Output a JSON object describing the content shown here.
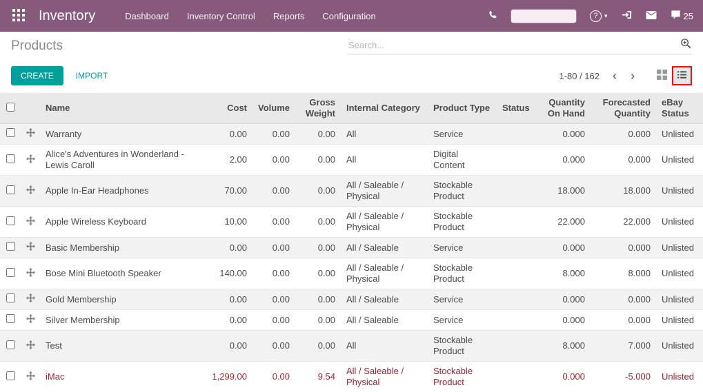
{
  "colors": {
    "brand": "#875A7B",
    "primary_button": "#00A09D",
    "danger_row": "#a2252f",
    "annotation": "#ec1111"
  },
  "navbar": {
    "app_title": "Inventory",
    "menu": [
      "Dashboard",
      "Inventory Control",
      "Reports",
      "Configuration"
    ],
    "help_label": "?",
    "messages_count": "25"
  },
  "page": {
    "title": "Products",
    "search_placeholder": "Search..."
  },
  "toolbar": {
    "create_label": "CREATE",
    "import_label": "IMPORT",
    "pager_text": "1-80 / 162",
    "prev_label": "‹",
    "next_label": "›",
    "active_view": "list"
  },
  "table": {
    "headers": [
      "Name",
      "Cost",
      "Volume",
      "Gross Weight",
      "Internal Category",
      "Product Type",
      "Status",
      "Quantity On Hand",
      "Forecasted Quantity",
      "eBay Status"
    ],
    "rows": [
      {
        "name": "Warranty",
        "cost": "0.00",
        "volume": "0.00",
        "gross_weight": "0.00",
        "category": "All",
        "type": "Service",
        "status": "",
        "qty_on_hand": "0.000",
        "forecasted": "0.000",
        "ebay_status": "Unlisted",
        "danger": false
      },
      {
        "name": "Alice's Adventures in Wonderland - Lewis Caroll",
        "cost": "2.00",
        "volume": "0.00",
        "gross_weight": "0.00",
        "category": "All",
        "type": "Digital Content",
        "status": "",
        "qty_on_hand": "0.000",
        "forecasted": "0.000",
        "ebay_status": "Unlisted",
        "danger": false
      },
      {
        "name": "Apple In-Ear Headphones",
        "cost": "70.00",
        "volume": "0.00",
        "gross_weight": "0.00",
        "category": "All / Saleable / Physical",
        "type": "Stockable Product",
        "status": "",
        "qty_on_hand": "18.000",
        "forecasted": "18.000",
        "ebay_status": "Unlisted",
        "danger": false
      },
      {
        "name": "Apple Wireless Keyboard",
        "cost": "10.00",
        "volume": "0.00",
        "gross_weight": "0.00",
        "category": "All / Saleable / Physical",
        "type": "Stockable Product",
        "status": "",
        "qty_on_hand": "22.000",
        "forecasted": "22.000",
        "ebay_status": "Unlisted",
        "danger": false
      },
      {
        "name": "Basic Membership",
        "cost": "0.00",
        "volume": "0.00",
        "gross_weight": "0.00",
        "category": "All / Saleable",
        "type": "Service",
        "status": "",
        "qty_on_hand": "0.000",
        "forecasted": "0.000",
        "ebay_status": "Unlisted",
        "danger": false
      },
      {
        "name": "Bose Mini Bluetooth Speaker",
        "cost": "140.00",
        "volume": "0.00",
        "gross_weight": "0.00",
        "category": "All / Saleable / Physical",
        "type": "Stockable Product",
        "status": "",
        "qty_on_hand": "8.000",
        "forecasted": "8.000",
        "ebay_status": "Unlisted",
        "danger": false
      },
      {
        "name": "Gold Membership",
        "cost": "0.00",
        "volume": "0.00",
        "gross_weight": "0.00",
        "category": "All / Saleable",
        "type": "Service",
        "status": "",
        "qty_on_hand": "0.000",
        "forecasted": "0.000",
        "ebay_status": "Unlisted",
        "danger": false
      },
      {
        "name": "Silver Membership",
        "cost": "0.00",
        "volume": "0.00",
        "gross_weight": "0.00",
        "category": "All / Saleable",
        "type": "Service",
        "status": "",
        "qty_on_hand": "0.000",
        "forecasted": "0.000",
        "ebay_status": "Unlisted",
        "danger": false
      },
      {
        "name": "Test",
        "cost": "0.00",
        "volume": "0.00",
        "gross_weight": "0.00",
        "category": "All",
        "type": "Stockable Product",
        "status": "",
        "qty_on_hand": "8.000",
        "forecasted": "7.000",
        "ebay_status": "Unlisted",
        "danger": false
      },
      {
        "name": "iMac",
        "cost": "1,299.00",
        "volume": "0.00",
        "gross_weight": "9.54",
        "category": "All / Saleable / Physical",
        "type": "Stockable Product",
        "status": "",
        "qty_on_hand": "0.000",
        "forecasted": "-5.000",
        "ebay_status": "Unlisted",
        "danger": true
      }
    ]
  }
}
